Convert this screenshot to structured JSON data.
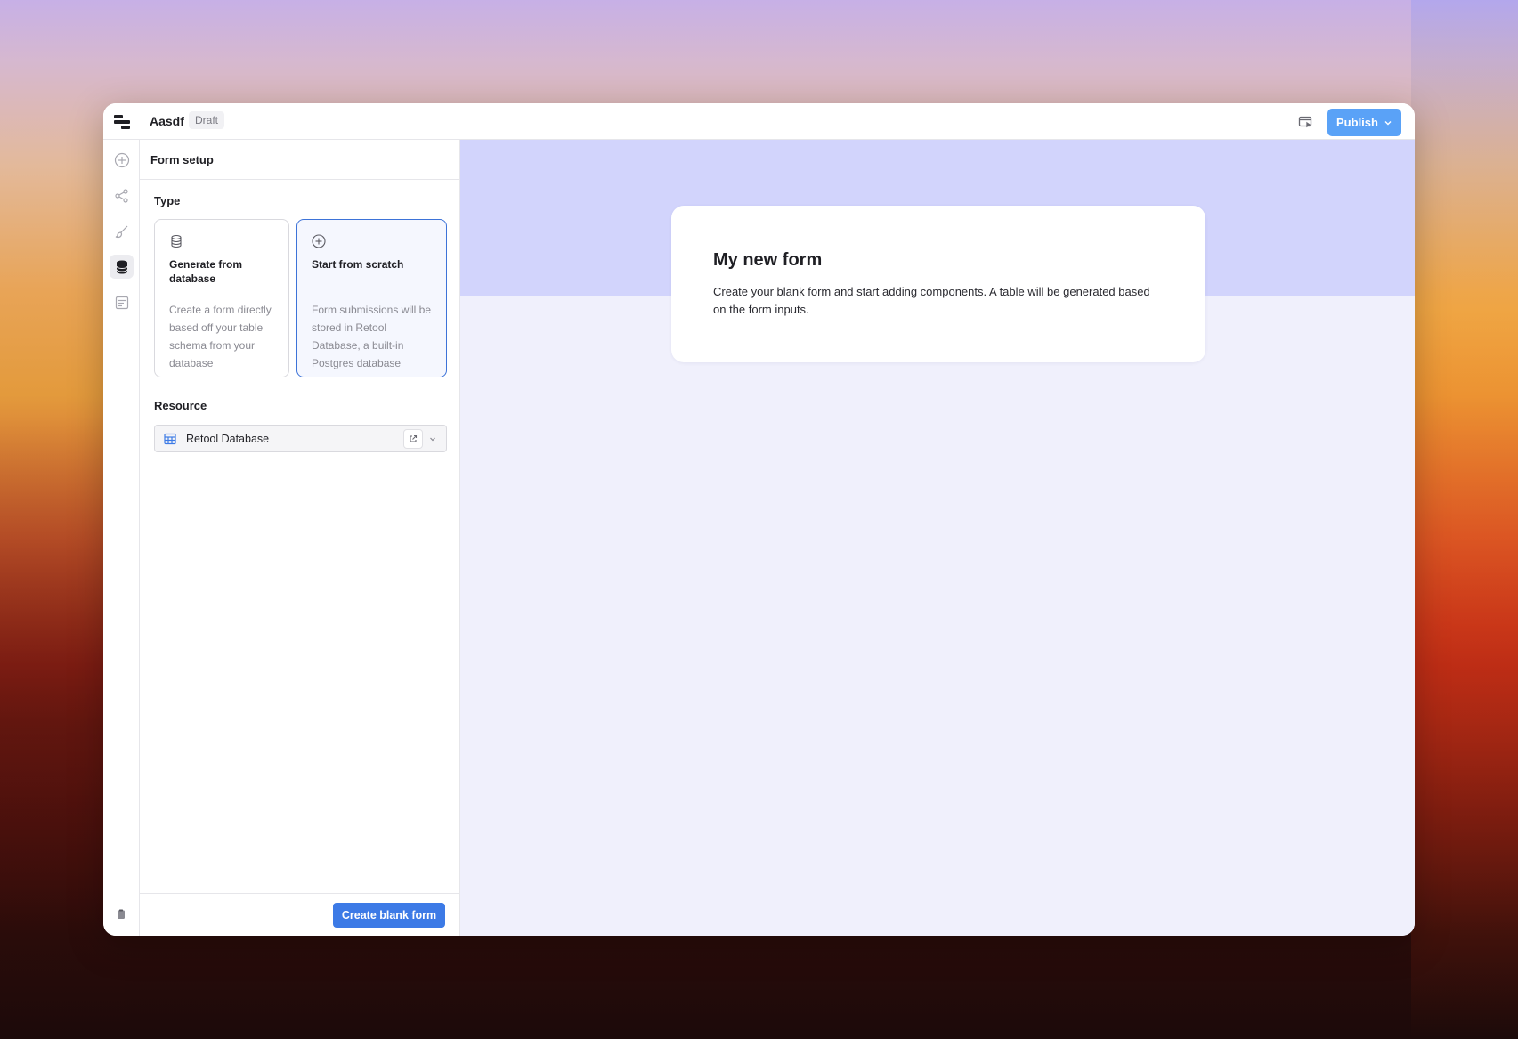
{
  "app": {
    "title": "Aasdf",
    "status_badge": "Draft",
    "publish_label": "Publish"
  },
  "rail": {
    "icons": [
      "add-icon",
      "share-icon",
      "brush-icon",
      "database-icon",
      "form-icon"
    ],
    "active": "database-icon",
    "bottom_icon": "clipboard-icon"
  },
  "panel": {
    "title": "Form setup",
    "type_label": "Type",
    "cards": [
      {
        "icon": "database-icon",
        "title": "Generate from database",
        "description": "Create a form directly based off your table schema from your database"
      },
      {
        "icon": "plus-circle-icon",
        "title": "Start from scratch",
        "description": "Form submissions will be stored in Retool Database, a built-in Postgres database",
        "selected": true
      }
    ],
    "resource_label": "Resource",
    "resource_value": "Retool Database",
    "create_button": "Create blank form"
  },
  "canvas": {
    "form_title": "My new form",
    "form_description": "Create your blank form and start adding components. A table will be generated based on the form inputs."
  },
  "colors": {
    "accent": "#3c7ae6",
    "publish": "#5aa2f7",
    "canvas_band": "#d2d4fc",
    "canvas_bg": "#f0f0fc"
  }
}
